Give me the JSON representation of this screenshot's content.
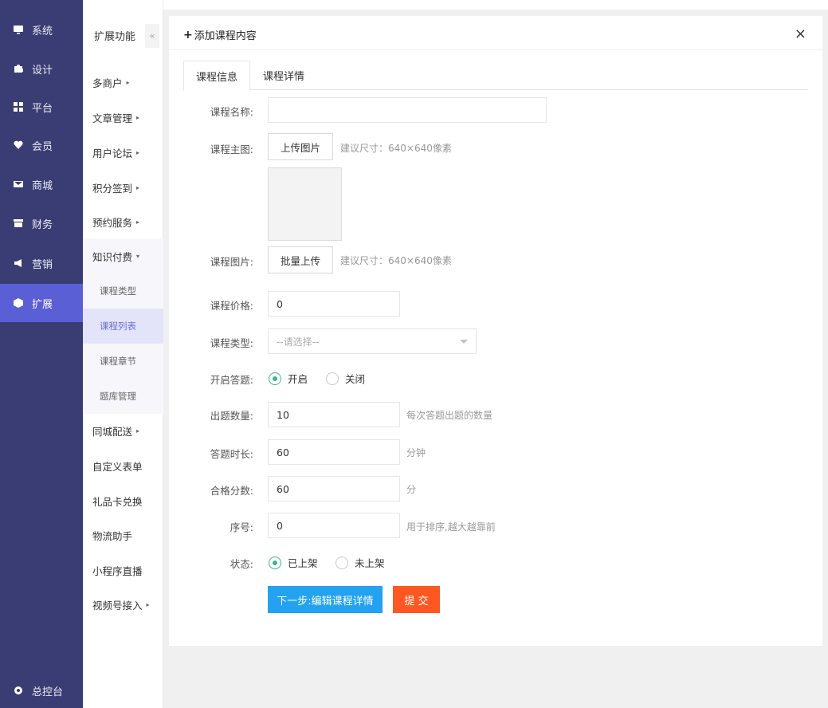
{
  "leftnav": {
    "items": [
      {
        "label": "系统",
        "icon": "monitor-icon"
      },
      {
        "label": "设计",
        "icon": "puzzle-icon"
      },
      {
        "label": "平台",
        "icon": "grid-icon"
      },
      {
        "label": "会员",
        "icon": "heart-icon"
      },
      {
        "label": "商城",
        "icon": "mail-icon"
      },
      {
        "label": "财务",
        "icon": "box-icon"
      },
      {
        "label": "营销",
        "icon": "megaphone-icon"
      },
      {
        "label": "扩展",
        "icon": "cube-icon"
      }
    ],
    "bottom": {
      "label": "总控台",
      "icon": "gear-icon"
    }
  },
  "subnav": {
    "header": "扩展功能",
    "collapse": "«",
    "items": [
      {
        "label": "多商户",
        "arrow": "▸"
      },
      {
        "label": "文章管理",
        "arrow": "▸"
      },
      {
        "label": "用户论坛",
        "arrow": "▸"
      },
      {
        "label": "积分签到",
        "arrow": "▸"
      },
      {
        "label": "预约服务",
        "arrow": "▸"
      },
      {
        "label": "知识付费",
        "arrow": "▾"
      }
    ],
    "children": [
      "课程类型",
      "课程列表",
      "课程章节",
      "题库管理"
    ],
    "items_after": [
      {
        "label": "同城配送",
        "arrow": "▸"
      },
      {
        "label": "自定义表单",
        "arrow": ""
      },
      {
        "label": "礼品卡兑换",
        "arrow": ""
      },
      {
        "label": "物流助手",
        "arrow": ""
      },
      {
        "label": "小程序直播",
        "arrow": ""
      },
      {
        "label": "视频号接入",
        "arrow": "▸"
      }
    ]
  },
  "modal": {
    "title": "添加课程内容",
    "title_icon": "+",
    "close": "×",
    "tabs": [
      "课程信息",
      "课程详情"
    ],
    "form": {
      "name_label": "课程名称:",
      "name_value": "",
      "main_img_label": "课程主图:",
      "upload_btn": "上传图片",
      "size_hint": "建议尺寸：640×640像素",
      "images_label": "课程图片:",
      "batch_btn": "批量上传",
      "size_hint2": "建议尺寸：640×640像素",
      "price_label": "课程价格:",
      "price_value": "0",
      "type_label": "课程类型:",
      "type_placeholder": "--请选择--",
      "quiz_label": "开启答题:",
      "quiz_on": "开启",
      "quiz_off": "关闭",
      "count_label": "出题数量:",
      "count_value": "10",
      "count_hint": "每次答题出题的数量",
      "duration_label": "答题时长:",
      "duration_value": "60",
      "duration_unit": "分钟",
      "pass_label": "合格分数:",
      "pass_value": "60",
      "pass_unit": "分",
      "order_label": "序号:",
      "order_value": "0",
      "order_hint": "用于排序,越大越靠前",
      "status_label": "状态:",
      "status_on": "已上架",
      "status_off": "未上架",
      "next_btn": "下一步:编辑课程详情",
      "submit_btn": "提 交"
    }
  },
  "colors": {
    "nav_bg": "#393d73",
    "nav_active": "#5a5fd6",
    "primary": "#23a2f1",
    "danger": "#ff5722",
    "radio": "#3eb38c"
  }
}
